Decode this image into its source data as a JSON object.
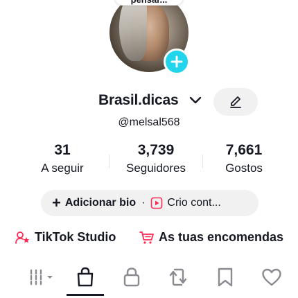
{
  "profile": {
    "thought_text": "pensar...",
    "username": "Brasil.dicas",
    "handle": "@melsal568"
  },
  "stats": [
    {
      "value": "31",
      "label": "A seguir"
    },
    {
      "value": "3,739",
      "label": "Seguidores"
    },
    {
      "value": "7,661",
      "label": "Gostos"
    }
  ],
  "bio": {
    "add_bio_label": "Adicionar bio",
    "separator": "·",
    "creator_label": "Crio cont..."
  },
  "links": {
    "studio_label": "TikTok Studio",
    "orders_label": "As tuas encomendas"
  },
  "colors": {
    "accent_cyan": "#20d5ec",
    "brand_red": "#fe2c55",
    "text_primary": "#161823",
    "pill_bg": "#f1f1f2"
  },
  "icons": {
    "add_badge": "plus-icon",
    "username_dropdown": "chevron-down-icon",
    "edit": "pencil-icon",
    "add_bio": "plus-icon",
    "creator": "play-square-icon",
    "studio": "person-star-icon",
    "orders": "cart-icon",
    "tabs": [
      "grid-filter-icon",
      "shopping-bag-icon",
      "lock-icon",
      "repost-icon",
      "bookmark-icon",
      "heart-icon"
    ]
  },
  "tabs": {
    "active_index": 1
  }
}
